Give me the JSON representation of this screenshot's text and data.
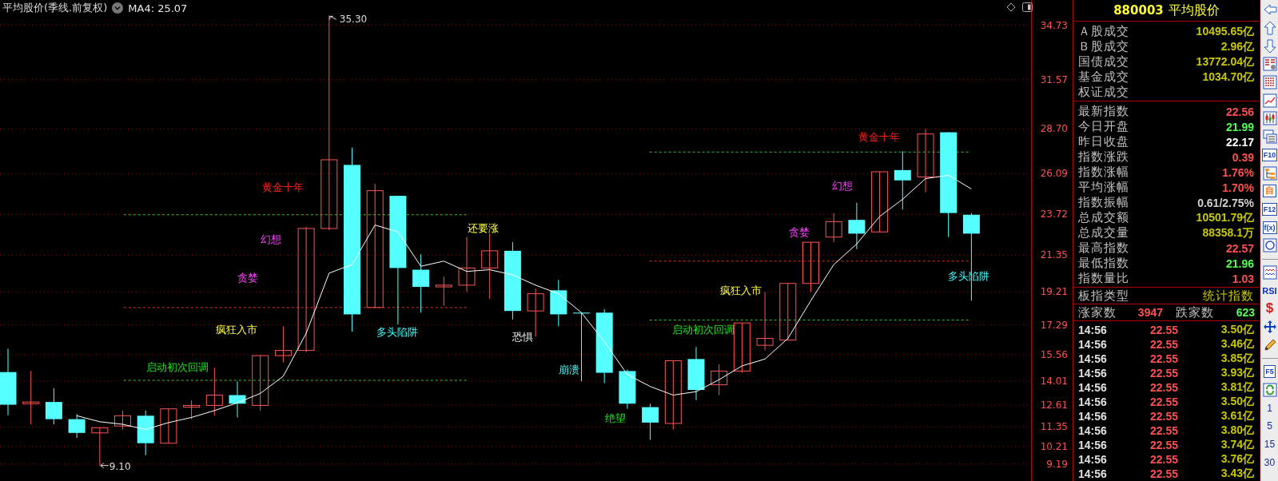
{
  "header": {
    "title": "平均股价(季线.前复权)",
    "indicator": "MA4: 25.07"
  },
  "chart": {
    "chart_data": {
      "type": "line",
      "ylim": [
        8.2,
        36.2
      ],
      "grid": true,
      "yticks": [
        {
          "value": 34.73,
          "label": "34.73"
        },
        {
          "value": 31.57,
          "label": "31.57"
        },
        {
          "value": 28.7,
          "label": "28.70"
        },
        {
          "value": 26.09,
          "label": "26.09"
        },
        {
          "value": 23.72,
          "label": "23.72"
        },
        {
          "value": 21.35,
          "label": "21.35"
        },
        {
          "value": 19.21,
          "label": "19.21"
        },
        {
          "value": 17.29,
          "label": "17.29"
        },
        {
          "value": 15.56,
          "label": "15.56"
        },
        {
          "value": 14.01,
          "label": "14.01"
        },
        {
          "value": 12.61,
          "label": "12.61"
        },
        {
          "value": 11.35,
          "label": "11.35"
        },
        {
          "value": 10.21,
          "label": "10.21"
        },
        {
          "value": 9.19,
          "label": "9.19"
        }
      ],
      "series": [
        {
          "type": "candlestick",
          "ohlc": [
            [
              14.54,
              15.9,
              12.03,
              12.64
            ],
            [
              12.7,
              14.6,
              11.5,
              12.8
            ],
            [
              12.8,
              13.6,
              11.5,
              11.8
            ],
            [
              11.8,
              12.1,
              10.7,
              11.0
            ],
            [
              11.0,
              11.3,
              9.1,
              11.3
            ],
            [
              11.4,
              12.3,
              11.2,
              12.0
            ],
            [
              12.0,
              12.3,
              9.7,
              10.4
            ],
            [
              10.4,
              12.4,
              10.4,
              12.4
            ],
            [
              12.5,
              12.9,
              11.8,
              12.6
            ],
            [
              12.6,
              14.8,
              12.0,
              13.2
            ],
            [
              13.2,
              14.0,
              11.9,
              12.7
            ],
            [
              12.6,
              15.5,
              12.3,
              15.5
            ],
            [
              15.5,
              17.2,
              15.1,
              15.8
            ],
            [
              15.8,
              23.0,
              15.7,
              22.9
            ],
            [
              22.9,
              35.3,
              22.8,
              26.9
            ],
            [
              26.6,
              27.6,
              16.9,
              17.9
            ],
            [
              18.3,
              25.5,
              18.3,
              25.1
            ],
            [
              24.8,
              24.8,
              17.3,
              20.6
            ],
            [
              20.5,
              21.4,
              18.0,
              19.5
            ],
            [
              19.5,
              20.1,
              18.4,
              19.6
            ],
            [
              19.6,
              22.4,
              19.2,
              20.6
            ],
            [
              20.6,
              22.6,
              18.8,
              21.6
            ],
            [
              21.6,
              22.1,
              17.6,
              18.1
            ],
            [
              18.1,
              19.4,
              16.6,
              19.1
            ],
            [
              19.3,
              19.9,
              17.2,
              17.9
            ],
            [
              18.0,
              18.0,
              14.0,
              17.95
            ],
            [
              18.0,
              18.2,
              13.9,
              14.5
            ],
            [
              14.6,
              14.7,
              12.4,
              12.7
            ],
            [
              12.5,
              12.7,
              10.6,
              11.6
            ],
            [
              11.55,
              15.2,
              11.2,
              15.2
            ],
            [
              15.3,
              16.0,
              12.9,
              13.5
            ],
            [
              13.8,
              15.0,
              13.2,
              14.6
            ],
            [
              14.6,
              17.4,
              14.5,
              17.4
            ],
            [
              16.1,
              19.2,
              15.8,
              16.5
            ],
            [
              16.4,
              19.7,
              16.4,
              19.7
            ],
            [
              19.7,
              22.1,
              19.2,
              22.1
            ],
            [
              22.4,
              23.8,
              22.1,
              23.3
            ],
            [
              23.4,
              24.4,
              21.7,
              22.6
            ],
            [
              22.7,
              26.2,
              22.7,
              26.2
            ],
            [
              26.3,
              27.4,
              24.0,
              25.7
            ],
            [
              25.9,
              28.7,
              25.0,
              28.4
            ],
            [
              28.5,
              28.5,
              22.4,
              23.8
            ],
            [
              23.7,
              23.8,
              18.7,
              22.6
            ]
          ]
        },
        {
          "type": "line",
          "color": "#ffffff",
          "values": [
            null,
            null,
            null,
            12.0,
            11.65,
            11.5,
            11.2,
            11.6,
            11.9,
            12.3,
            12.75,
            13.3,
            14.3,
            16.8,
            20.3,
            20.8,
            23.1,
            22.7,
            20.7,
            21.0,
            20.4,
            20.5,
            20.2,
            19.6,
            19.1,
            18.0,
            16.3,
            14.4,
            13.7,
            13.2,
            13.4,
            14.1,
            14.9,
            15.3,
            16.5,
            18.7,
            20.8,
            22.0,
            23.6,
            24.6,
            25.8,
            26.0,
            25.2
          ]
        }
      ],
      "ref_lines": [
        {
          "axis": "y",
          "value": 23.7,
          "color": "#20d020"
        },
        {
          "axis": "y",
          "value": 18.3,
          "color": "#ff2020"
        },
        {
          "axis": "y",
          "value": 14.06,
          "color": "#20d020"
        },
        {
          "axis": "y",
          "value": 27.35,
          "color": "#20d020"
        },
        {
          "axis": "y",
          "value": 21.0,
          "color": "#ff2020"
        },
        {
          "axis": "y",
          "value": 17.57,
          "color": "#20d020"
        }
      ],
      "annotations": [
        "35.30",
        "9.10",
        "黄金十年",
        "幻想",
        "贪婪",
        "疯狂入市",
        "启动初次回调",
        "多头陷阱",
        "还要涨",
        "恐惧",
        "崩溃",
        "绝望",
        "黄金十年",
        "幻想",
        "贪婪",
        "疯狂入市",
        "启动初次回调",
        "多头陷阱"
      ]
    }
  },
  "panel": {
    "code": "880003",
    "name": "平均股价",
    "volume_rows": [
      {
        "label": "Ａ股成交",
        "value": "10495.65亿",
        "color": "#c8c800"
      },
      {
        "label": "Ｂ股成交",
        "value": "2.96亿",
        "color": "#c8c800"
      },
      {
        "label": "国债成交",
        "value": "13772.04亿",
        "color": "#c8c800"
      },
      {
        "label": "基金成交",
        "value": "1034.70亿",
        "color": "#c8c800"
      },
      {
        "label": "权证成交"
      }
    ],
    "index_rows": [
      {
        "label": "最新指数",
        "value": "22.56",
        "color": "#ff5050"
      },
      {
        "label": "今日开盘",
        "value": "21.99",
        "color": "#50ff50"
      },
      {
        "label": "昨日收盘",
        "value": "22.17",
        "color": "#ffffff"
      },
      {
        "label": "指数涨跌",
        "value": "0.39",
        "color": "#ff5050"
      },
      {
        "label": "指数涨幅",
        "value": "1.76%",
        "color": "#ff5050"
      },
      {
        "label": "平均涨幅",
        "value": "1.70%",
        "color": "#ff5050"
      },
      {
        "label": "指数振幅",
        "value": "0.61/2.75%",
        "color": "#d0d0d0"
      },
      {
        "label": "总成交额",
        "value": "10501.79亿",
        "color": "#c8c800"
      },
      {
        "label": "总成交量",
        "value": "88358.1万",
        "color": "#c8c800"
      },
      {
        "label": "最高指数",
        "value": "22.57",
        "color": "#ff5050"
      },
      {
        "label": "最低指数",
        "value": "21.96",
        "color": "#50ff50"
      },
      {
        "label": "指数量比",
        "value": "1.03",
        "color": "#ff5050"
      }
    ],
    "type_row": {
      "label": "板指类型",
      "value": "统计指数"
    },
    "breadth": {
      "up_label": "涨家数",
      "up_value": "3947",
      "down_label": "跌家数",
      "down_value": "623"
    },
    "ticks": [
      {
        "time": "14:56",
        "price": "22.55",
        "volume": "3.50亿"
      },
      {
        "time": "14:56",
        "price": "22.55",
        "volume": "3.46亿"
      },
      {
        "time": "14:56",
        "price": "22.55",
        "volume": "3.85亿"
      },
      {
        "time": "14:56",
        "price": "22.55",
        "volume": "3.93亿"
      },
      {
        "time": "14:56",
        "price": "22.55",
        "volume": "3.81亿"
      },
      {
        "time": "14:56",
        "price": "22.55",
        "volume": "3.50亿"
      },
      {
        "time": "14:56",
        "price": "22.55",
        "volume": "3.61亿"
      },
      {
        "time": "14:56",
        "price": "22.55",
        "volume": "3.80亿"
      },
      {
        "time": "14:56",
        "price": "22.55",
        "volume": "3.74亿"
      },
      {
        "time": "14:56",
        "price": "22.55",
        "volume": "3.76亿"
      },
      {
        "time": "14:56",
        "price": "22.55",
        "volume": "3.43亿"
      }
    ]
  },
  "toolbar": [
    {
      "kind": "left"
    },
    {
      "kind": "up"
    },
    {
      "kind": "down"
    },
    {
      "kind": "report"
    },
    {
      "kind": "table"
    },
    {
      "kind": "linechart"
    },
    {
      "kind": "candles"
    },
    {
      "kind": "windows"
    },
    {
      "kind": "boxed",
      "label": "F10"
    },
    {
      "kind": "tree"
    },
    {
      "kind": "boxed-orange",
      "label": "自"
    },
    {
      "kind": "boxed",
      "label": "F12"
    },
    {
      "kind": "boxed",
      "label": "f(x)"
    },
    {
      "kind": "circle"
    },
    {
      "kind": "separator"
    },
    {
      "kind": "wave"
    },
    {
      "kind": "text",
      "label": "RSI"
    },
    {
      "kind": "text-red",
      "label": "$"
    },
    {
      "kind": "move"
    },
    {
      "kind": "pencil"
    },
    {
      "kind": "separator"
    },
    {
      "kind": "boxed",
      "label": "F5"
    },
    {
      "kind": "refresh"
    },
    {
      "kind": "plain",
      "label": "1"
    },
    {
      "kind": "plain",
      "label": "5"
    },
    {
      "kind": "plain",
      "label": "15"
    },
    {
      "kind": "plain",
      "label": "30"
    }
  ]
}
